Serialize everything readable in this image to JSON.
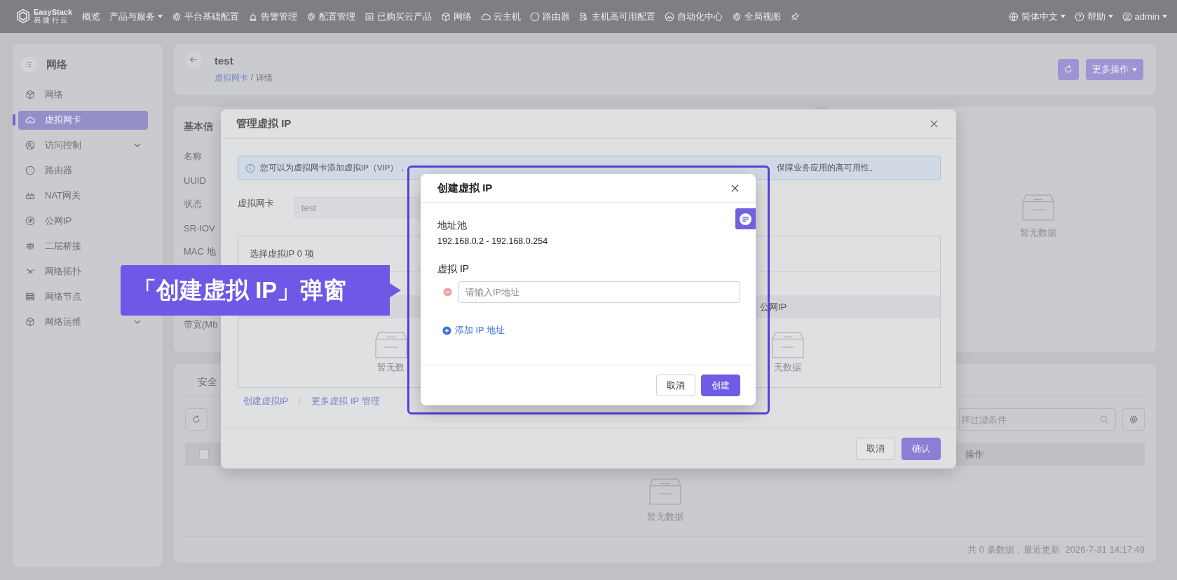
{
  "top_bar": {
    "logo_name": "EasyStack",
    "logo_tagline": "易 捷 行 云",
    "menu": [
      {
        "label": "概览",
        "dropdown": false
      },
      {
        "label": "产品与服务",
        "dropdown": true
      },
      {
        "label": "平台基础配置",
        "dropdown": false
      },
      {
        "label": "告警管理",
        "dropdown": false
      },
      {
        "label": "配置管理",
        "dropdown": false
      },
      {
        "label": "已购买云产品",
        "dropdown": false
      },
      {
        "label": "网络",
        "dropdown": false
      },
      {
        "label": "云主机",
        "dropdown": false
      },
      {
        "label": "路由器",
        "dropdown": false
      },
      {
        "label": "主机高可用配置",
        "dropdown": false
      },
      {
        "label": "自动化中心",
        "dropdown": false
      },
      {
        "label": "全局视图",
        "dropdown": false
      }
    ],
    "user_menu": [
      {
        "label": "简体中文",
        "dropdown": true
      },
      {
        "label": "帮助",
        "dropdown": true
      },
      {
        "label": "admin",
        "dropdown": true
      }
    ]
  },
  "sidebar": {
    "title": "网络",
    "items": [
      {
        "label": "网络",
        "selected": false,
        "expandable": false
      },
      {
        "label": "虚拟网卡",
        "selected": true,
        "expandable": false
      },
      {
        "label": "访问控制",
        "selected": false,
        "expandable": true
      },
      {
        "label": "路由器",
        "selected": false,
        "expandable": false
      },
      {
        "label": "NAT网关",
        "selected": false,
        "expandable": false
      },
      {
        "label": "公网IP",
        "selected": false,
        "expandable": false
      },
      {
        "label": "二层桥接",
        "selected": false,
        "expandable": false
      },
      {
        "label": "网络拓扑",
        "selected": false
      },
      {
        "label": "网络节点",
        "selected": false
      },
      {
        "label": "网络运维",
        "selected": false,
        "expandable": true
      }
    ]
  },
  "page_header": {
    "title": "test",
    "breadcrumb_link": "虚拟网卡",
    "breadcrumb_separator": "/",
    "breadcrumb_current": "详情",
    "more_button": "更多操作"
  },
  "basic_info": {
    "title": "基本信",
    "labels": [
      "名称",
      "UUID",
      "状态",
      "SR-IOV",
      "MAC 地",
      "带宽(Mb"
    ]
  },
  "side_panel": {
    "empty_text": "暂无数据"
  },
  "security": {
    "tab": "安全",
    "search_placeholder": "择过滤条件",
    "select_all_checked": false,
    "column": "操作",
    "empty_text": "暂无数据",
    "footer_text": "共 0 条数据，最近更新",
    "updated_at": "2026-7-31 14:17:49"
  },
  "manage_dialog": {
    "title": "管理虚拟 IP",
    "info_start": "您可以为虚拟网卡添加虚拟IP（VIP），",
    "info_end": "保障业务应用的高可用性。",
    "nic_label": "虚拟网卡",
    "nic_value": "test",
    "selection_text": "选择虚拟IP 0 项",
    "column": "公网IP",
    "left_empty": "暂无数",
    "right_empty": "无数据",
    "links": [
      "创建虚拟IP",
      "更多虚拟 IP 管理"
    ],
    "buttons": [
      {
        "label": "取消",
        "primary": false
      },
      {
        "label": "确认",
        "primary": true
      }
    ]
  },
  "create_dialog": {
    "title": "创建虚拟 IP",
    "pool_label": "地址池",
    "pool_range": "192.168.0.2 - 192.168.0.254",
    "ip_label": "虚拟 IP",
    "ip_placeholder": "请输入IP地址",
    "add_link": "添加 IP 地址",
    "buttons": [
      {
        "label": "取消",
        "primary": false
      },
      {
        "label": "创建",
        "primary": true
      }
    ]
  },
  "callout": {
    "text": "「创建虚拟 IP」弹窗"
  }
}
